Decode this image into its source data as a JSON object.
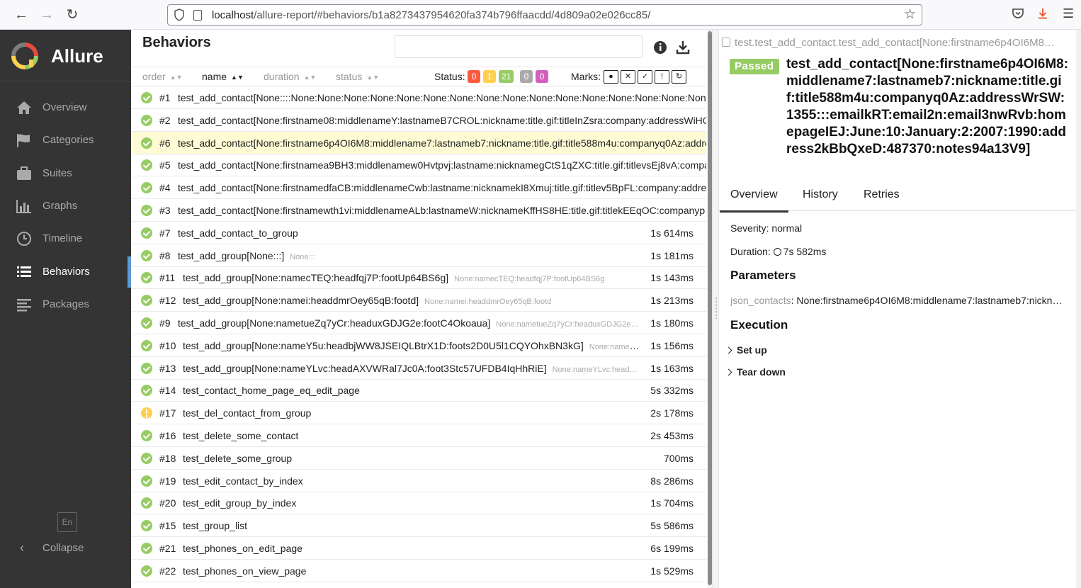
{
  "browser": {
    "url_host": "localhost",
    "url_path": "/allure-report/#behaviors/b1a8273437954620fa374b796ffaacdd/4d809a02e026cc85/"
  },
  "sidebar": {
    "brand": "Allure",
    "items": [
      {
        "label": "Overview",
        "icon": "home-icon"
      },
      {
        "label": "Categories",
        "icon": "flag-icon"
      },
      {
        "label": "Suites",
        "icon": "briefcase-icon"
      },
      {
        "label": "Graphs",
        "icon": "bar-chart-icon"
      },
      {
        "label": "Timeline",
        "icon": "clock-icon"
      },
      {
        "label": "Behaviors",
        "icon": "list-icon",
        "active": true
      },
      {
        "label": "Packages",
        "icon": "align-left-icon"
      }
    ],
    "language": "En",
    "collapse": "Collapse"
  },
  "behaviors": {
    "title": "Behaviors",
    "sort": {
      "order": "order",
      "name": "name",
      "duration": "duration",
      "status": "status"
    },
    "status_label": "Status:",
    "status_counts": [
      {
        "value": "0",
        "color": "#fd5a3e"
      },
      {
        "value": "1",
        "color": "#ffd050"
      },
      {
        "value": "21",
        "color": "#97cc64"
      },
      {
        "value": "0",
        "color": "#aaaaaa"
      },
      {
        "value": "0",
        "color": "#d35ebe"
      }
    ],
    "marks_label": "Marks:",
    "rows": [
      {
        "num": "#1",
        "name": "test_add_contact[None::::None:None:None:None:None:None:None:None:None:None:None:None:None:None:None:None:None",
        "param": "",
        "duration": "",
        "status": "passed"
      },
      {
        "num": "#2",
        "name": "test_add_contact[None:firstname08:middlenameY:lastnameB7CROL:nickname:title.gif:titleInZsra:company:addressWiHC",
        "param": "",
        "duration": "",
        "status": "passed"
      },
      {
        "num": "#6",
        "name": "test_add_contact[None:firstname6p4OI6M8:middlename7:lastnameb7:nickname:title.gif:title588m4u:companyq0Az:addre",
        "param": "",
        "duration": "",
        "status": "passed",
        "selected": true
      },
      {
        "num": "#5",
        "name": "test_add_contact[None:firstnamea9BH3:middlenamew0Hvtpvj:lastname:nicknamegCtS1qZXC:title.gif:titlevsEj8vA:compa",
        "param": "",
        "duration": "",
        "status": "passed"
      },
      {
        "num": "#4",
        "name": "test_add_contact[None:firstnamedfaCB:middlenameCwb:lastname:nicknamekI8Xmuj:title.gif:titlev5BpFL:company:addres",
        "param": "",
        "duration": "",
        "status": "passed"
      },
      {
        "num": "#3",
        "name": "test_add_contact[None:firstnamewth1vi:middlenameALb:lastnameW:nicknameKffHS8HE:title.gif:titlekEEqOC:companyp",
        "param": "",
        "duration": "",
        "status": "passed"
      },
      {
        "num": "#7",
        "name": "test_add_contact_to_group",
        "param": "",
        "duration": "1s 614ms",
        "status": "passed"
      },
      {
        "num": "#8",
        "name": "test_add_group[None:::]",
        "param": "None:::",
        "duration": "1s 181ms",
        "status": "passed"
      },
      {
        "num": "#11",
        "name": "test_add_group[None:namecTEQ:headfqj7P:footUp64BS6g]",
        "param": "None:namecTEQ:headfqj7P:footUp64BS6g",
        "duration": "1s 143ms",
        "status": "passed"
      },
      {
        "num": "#12",
        "name": "test_add_group[None:namei:headdmrOey65qB:footd]",
        "param": "None:namei:headdmrOey65qB:footd",
        "duration": "1s 213ms",
        "status": "passed"
      },
      {
        "num": "#9",
        "name": "test_add_group[None:nametueZq7yCr:headuxGDJG2e:footC4Okoaua]",
        "param": "None:nametueZq7yCr:headuxGDJG2e…",
        "duration": "1s 180ms",
        "status": "passed"
      },
      {
        "num": "#10",
        "name": "test_add_group[None:nameY5u:headbjWW8JSEIQLBtrX1D:foots2D0U5l1CQYOhxBN3kG]",
        "param": "None:nameY…",
        "duration": "1s 156ms",
        "status": "passed"
      },
      {
        "num": "#13",
        "name": "test_add_group[None:nameYLvc:headAXVWRal7Jc0A:foot3Stc57UFDB4IqHhRiE]",
        "param": "None:nameYLvc:head…",
        "duration": "1s 163ms",
        "status": "passed"
      },
      {
        "num": "#14",
        "name": "test_contact_home_page_eq_edit_page",
        "param": "",
        "duration": "5s 332ms",
        "status": "passed"
      },
      {
        "num": "#17",
        "name": "test_del_contact_from_group",
        "param": "",
        "duration": "2s 178ms",
        "status": "broken"
      },
      {
        "num": "#16",
        "name": "test_delete_some_contact",
        "param": "",
        "duration": "2s 453ms",
        "status": "passed"
      },
      {
        "num": "#18",
        "name": "test_delete_some_group",
        "param": "",
        "duration": "700ms",
        "status": "passed"
      },
      {
        "num": "#19",
        "name": "test_edit_contact_by_index",
        "param": "",
        "duration": "8s 286ms",
        "status": "passed"
      },
      {
        "num": "#20",
        "name": "test_edit_group_by_index",
        "param": "",
        "duration": "1s 704ms",
        "status": "passed"
      },
      {
        "num": "#15",
        "name": "test_group_list",
        "param": "",
        "duration": "5s 586ms",
        "status": "passed"
      },
      {
        "num": "#21",
        "name": "test_phones_on_edit_page",
        "param": "",
        "duration": "6s 199ms",
        "status": "passed"
      },
      {
        "num": "#22",
        "name": "test_phones_on_view_page",
        "param": "",
        "duration": "1s 529ms",
        "status": "passed"
      }
    ]
  },
  "detail": {
    "breadcrumb": "test.test_add_contact.test_add_contact[None:firstname6p4OI6M8…",
    "status": "Passed",
    "title": "test_add_contact[None:firstname6p4OI6M8:middlename7:lastnameb7:nickname:title.gif:title588m4u:companyq0Az:addressWrSW:1355:::emailkRT:email2n:email3nwRvb:homepageIEJ:June:10:January:2:2007:1990:address2kBbQxeD:487370:notes94a13V9]",
    "tabs": [
      "Overview",
      "History",
      "Retries"
    ],
    "severity": "Severity: normal",
    "duration_label": "Duration:",
    "duration_value": "7s 582ms",
    "parameters_title": "Parameters",
    "param_key": "json_contacts",
    "param_value": ": None:firstname6p4OI6M8:middlename7:lastnameb7:nickn…",
    "execution_title": "Execution",
    "setup": "Set up",
    "teardown": "Tear down"
  },
  "colors": {
    "sidebar_bg": "#343434",
    "passed": "#97cc64",
    "broken": "#ffd050",
    "selected_row": "#fffbd5",
    "active_accent": "#5c9bd5"
  }
}
